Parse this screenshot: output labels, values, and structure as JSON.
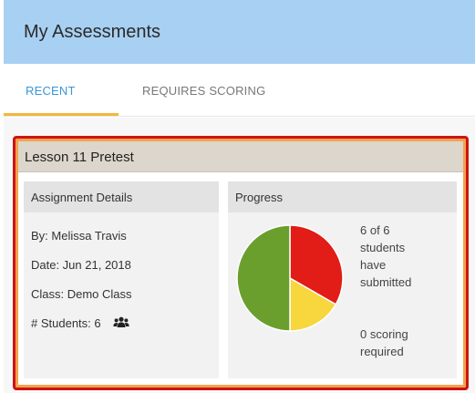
{
  "header": {
    "title": "My Assessments"
  },
  "tabs": [
    {
      "label": "RECENT",
      "active": true
    },
    {
      "label": "REQUIRES SCORING",
      "active": false
    }
  ],
  "assessment": {
    "title": "Lesson 11 Pretest",
    "details": {
      "header": "Assignment Details",
      "by": "By: Melissa Travis",
      "date": "Date: Jun 21, 2018",
      "class": "Class: Demo Class",
      "students": "# Students: 6",
      "students_icon": "people-icon"
    },
    "progress": {
      "header": "Progress",
      "submitted_lines": [
        "6 of 6",
        "students",
        "have",
        "submitted"
      ],
      "scoring_lines": [
        "0 scoring",
        "required"
      ],
      "pie": [
        {
          "value": 0.5,
          "color": "#6a9f2e"
        },
        {
          "value": 0.333,
          "color": "#e21c16"
        },
        {
          "value": 0.167,
          "color": "#f7d63e"
        }
      ]
    }
  },
  "colors": {
    "header_bg": "#a8d0f2",
    "active_tab": "#3a96d8",
    "tab_underline": "#f4b63d",
    "card_border_red": "#cc1414",
    "card_border_orange": "#f4a24c"
  }
}
